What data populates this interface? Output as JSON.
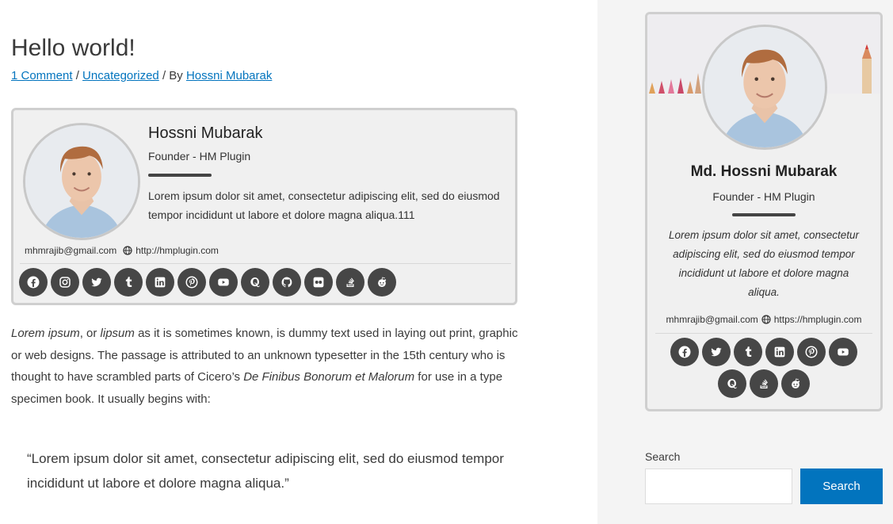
{
  "post": {
    "title": "Hello world!",
    "meta": {
      "comments": "1 Comment",
      "sep1": " / ",
      "category": "Uncategorized",
      "by": " / By ",
      "author": "Hossni Mubarak"
    }
  },
  "author_box": {
    "name": "Hossni Mubarak",
    "role": "Founder - HM Plugin",
    "description": "Lorem ipsum dolor sit amet, consectetur adipiscing elit, sed do eiusmod tempor incididunt ut labore et dolore magna aliqua.111",
    "email": "mhmrajib@gmail.com",
    "website": "http://hmplugin.com",
    "social_icons": [
      "facebook-icon",
      "instagram-icon",
      "twitter-icon",
      "tumblr-icon",
      "linkedin-icon",
      "pinterest-icon",
      "youtube-icon",
      "quora-icon",
      "github-icon",
      "flickr-icon",
      "stackoverflow-icon",
      "reddit-icon"
    ]
  },
  "body": {
    "p1_em1": "Lorem ipsum",
    "p1_t1": ", or ",
    "p1_em2": "lipsum",
    "p1_t2": " as it is sometimes known, is dummy text used in laying out print, graphic or web designs. The passage is attributed to an unknown typesetter in the 15th century who is thought to have scrambled parts of Cicero’s ",
    "p1_em3": "De Finibus Bonorum et Malorum",
    "p1_t3": " for use in a type specimen book. It usually begins with:",
    "quote": "“Lorem ipsum dolor sit amet, consectetur adipiscing elit, sed do eiusmod tempor incididunt ut labore et dolore magna aliqua.”"
  },
  "sidebar_card": {
    "name": "Md. Hossni Mubarak",
    "role": "Founder - HM Plugin",
    "description": "Lorem ipsum dolor sit amet, consectetur adipiscing elit, sed do eiusmod tempor incididunt ut labore et dolore magna aliqua.",
    "email": "mhmrajib@gmail.com",
    "website": "https://hmplugin.com",
    "social_icons": [
      "facebook-icon",
      "twitter-icon",
      "tumblr-icon",
      "linkedin-icon",
      "pinterest-icon",
      "youtube-icon",
      "quora-icon",
      "stackoverflow-icon",
      "reddit-icon"
    ]
  },
  "search": {
    "label": "Search",
    "value": "",
    "button": "Search"
  },
  "colors": {
    "link": "#0274be",
    "icon_bg": "#464646",
    "box_bg": "#f0f0f0",
    "sidebar_bg": "#f4f4f4",
    "button_bg": "#0274be"
  }
}
